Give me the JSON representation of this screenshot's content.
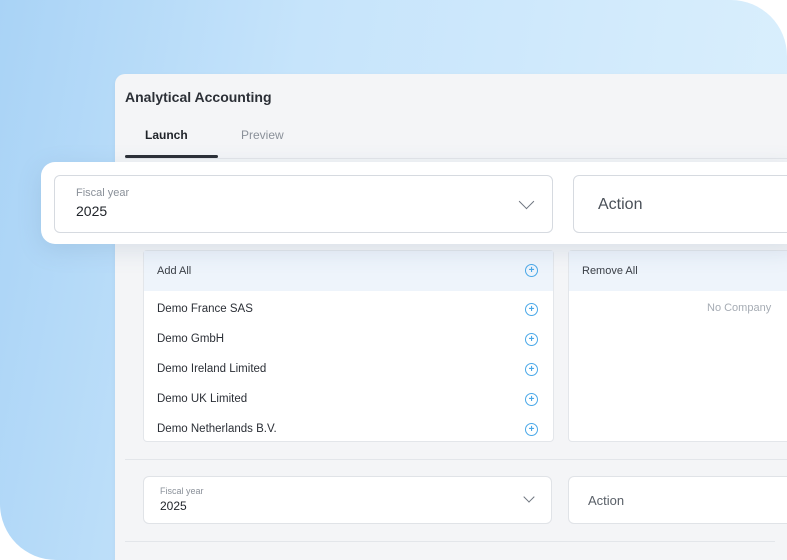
{
  "app": {
    "title": "Analytical Accounting"
  },
  "tabs": [
    {
      "label": "Launch",
      "active": true
    },
    {
      "label": "Preview",
      "active": false
    }
  ],
  "form": {
    "fiscal_year_label": "Fiscal year",
    "fiscal_year_value": "2025",
    "action_placeholder": "Action"
  },
  "companies": {
    "add_all_label": "Add All",
    "remove_all_label": "Remove All",
    "available": [
      "Demo France SAS",
      "Demo GmbH",
      "Demo Ireland Limited",
      "Demo UK Limited",
      "Demo Netherlands B.V."
    ],
    "selected_empty_text": "No Company"
  },
  "icons": {
    "chevron": "chevron-down-icon",
    "add": "add-circle-icon"
  },
  "colors": {
    "accent": "#4aa8e8",
    "background_gradient_start": "#a9d3f6",
    "background_gradient_end": "#dcf0fd"
  }
}
